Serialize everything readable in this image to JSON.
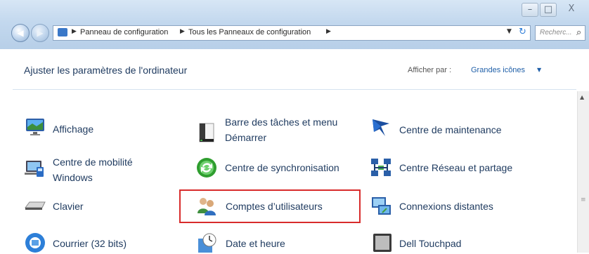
{
  "window": {
    "minimize_label": "–",
    "maximize_label": "□",
    "close_label": "X"
  },
  "nav": {
    "back_label": "◀",
    "forward_label": "▶"
  },
  "address": {
    "sep": "▶",
    "breadcrumb": [
      "Panneau de configuration",
      "Tous les Panneaux de configuration"
    ],
    "dropdown": "▼",
    "refresh": "↻"
  },
  "search": {
    "placeholder": "Recherc...",
    "icon": "⌕"
  },
  "header": {
    "title": "Ajuster les paramètres de l'ordinateur",
    "view_by_label": "Afficher par :",
    "view_by_value": "Grandes icônes",
    "view_by_caret": "▼"
  },
  "scroll": {
    "up": "▲",
    "grip": "≡"
  },
  "items": [
    {
      "id": "affichage",
      "line1": "Affichage",
      "line2": "",
      "icon": "display-icon"
    },
    {
      "id": "barre-taches",
      "line1": "Barre des tâches et menu",
      "line2": "Démarrer",
      "icon": "taskbar-icon"
    },
    {
      "id": "centre-maintenance",
      "line1": "Centre de maintenance",
      "line2": "",
      "icon": "flag-icon"
    },
    {
      "id": "centre-mobilite",
      "line1": "Centre de mobilité",
      "line2": "Windows",
      "icon": "mobility-icon"
    },
    {
      "id": "centre-synchro",
      "line1": "Centre de synchronisation",
      "line2": "",
      "icon": "sync-icon"
    },
    {
      "id": "centre-reseau",
      "line1": "Centre Réseau et partage",
      "line2": "",
      "icon": "network-icon"
    },
    {
      "id": "clavier",
      "line1": "Clavier",
      "line2": "",
      "icon": "keyboard-icon"
    },
    {
      "id": "comptes-utilisateurs",
      "line1": "Comptes d’utilisateurs",
      "line2": "",
      "icon": "users-icon"
    },
    {
      "id": "connexions-distantes",
      "line1": "Connexions distantes",
      "line2": "",
      "icon": "remote-connection-icon"
    },
    {
      "id": "courrier",
      "line1": "Courrier (32 bits)",
      "line2": "",
      "icon": "mail-icon"
    },
    {
      "id": "date-heure",
      "line1": "Date et heure",
      "line2": "",
      "icon": "clock-icon"
    },
    {
      "id": "dell-touchpad",
      "line1": "Dell Touchpad",
      "line2": "",
      "icon": "touchpad-icon"
    }
  ],
  "colors": {
    "title_text": "#1e3a5f",
    "link": "#1f5fa8",
    "highlight_border": "#d82b2b"
  }
}
